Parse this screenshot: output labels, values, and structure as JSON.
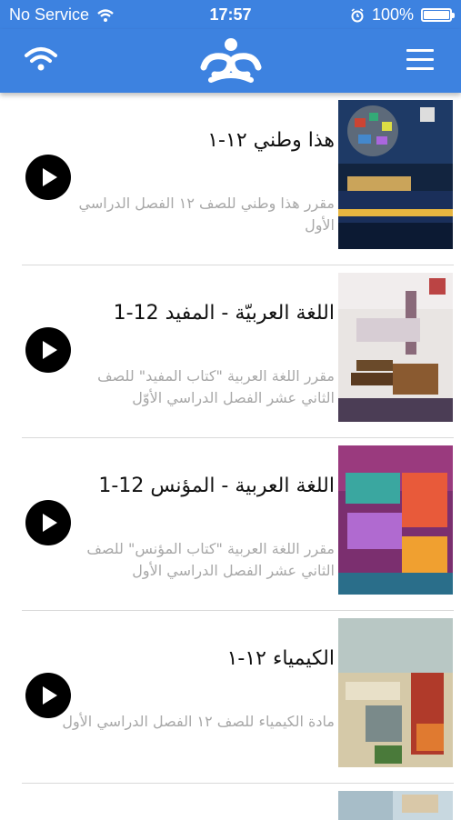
{
  "status": {
    "carrier": "No Service",
    "time": "17:57",
    "battery": "100%"
  },
  "nav": {
    "logo_icon": "app-logo-icon",
    "menu_icon": "hamburger-menu-icon",
    "wifi_icon": "wifi-icon"
  },
  "courses": [
    {
      "title": "هذا وطني ١٢-١",
      "description": "مقرر هذا وطني للصف ١٢ الفصل الدراسي الأول"
    },
    {
      "title": "اللغة العربيّة - المفيد 12-1",
      "description": "مقرر اللغة العربية \"كتاب المفيد\" للصف الثاني عشر الفصل الدراسي الأوّل"
    },
    {
      "title": "اللغة العربية - المؤنس 12-1",
      "description": "مقرر اللغة العربية \"كتاب المؤنس\" للصف الثاني عشر الفصل الدراسي الأول"
    },
    {
      "title": "الكيمياء ١٢-١",
      "description": "مادة الكيمياء للصف ١٢ الفصل الدراسي الأول"
    }
  ],
  "colors": {
    "bar": "#3d82e0",
    "play": "#000000",
    "desc": "#a8a8a8"
  }
}
